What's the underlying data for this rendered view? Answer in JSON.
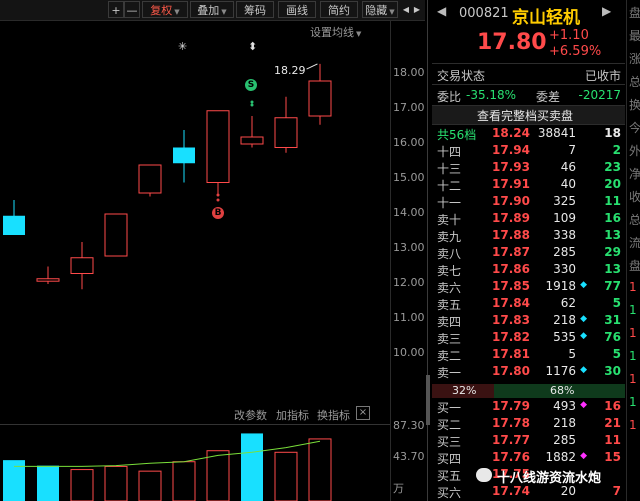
{
  "toolbar": {
    "plus": "+",
    "minus": "—",
    "fuquan": "复权",
    "diejia": "叠加",
    "chouma": "筹码",
    "huaxian": "画线",
    "jianyue": "简约",
    "yincang": "隐藏",
    "prev": "◀",
    "next": "▶"
  },
  "chart": {
    "settings_label": "设置均线",
    "marker_star": "✳",
    "marker_updown": "⬍",
    "high_label": "18.29",
    "s_marker": "S",
    "b_marker": "B",
    "y_ticks": [
      "18.00",
      "17.00",
      "16.00",
      "15.00",
      "14.00",
      "13.00",
      "12.00",
      "11.00",
      "10.00"
    ],
    "vol_ticks": [
      "87.30",
      "43.70",
      "万"
    ],
    "vol_buttons": [
      "改参数",
      "加指标",
      "换指标"
    ],
    "close_glyph": "×"
  },
  "chart_data": {
    "type": "candlestick",
    "candles": [
      {
        "open": 13.4,
        "close": 13.95,
        "high": 14.4,
        "low": 13.4,
        "color": "cyan"
      },
      {
        "open": 12.15,
        "close": 12.08,
        "high": 12.5,
        "low": 12.0,
        "color": "red"
      },
      {
        "open": 12.3,
        "close": 12.75,
        "high": 13.2,
        "low": 11.85,
        "color": "red"
      },
      {
        "open": 12.8,
        "close": 14.0,
        "high": 14.0,
        "low": 12.8,
        "color": "red"
      },
      {
        "open": 15.4,
        "close": 14.6,
        "high": 15.4,
        "low": 14.5,
        "color": "red"
      },
      {
        "open": 15.9,
        "close": 15.45,
        "high": 16.4,
        "low": 14.9,
        "color": "cyan"
      },
      {
        "open": 14.9,
        "close": 16.95,
        "high": 16.95,
        "low": 14.5,
        "color": "red"
      },
      {
        "open": 16.0,
        "close": 16.2,
        "high": 16.8,
        "low": 15.9,
        "color": "red"
      },
      {
        "open": 15.9,
        "close": 16.75,
        "high": 17.35,
        "low": 15.75,
        "color": "red"
      },
      {
        "open": 16.8,
        "close": 17.8,
        "high": 18.29,
        "low": 16.55,
        "color": "red"
      }
    ],
    "volumes": [
      {
        "v": 52,
        "color": "cyan"
      },
      {
        "v": 45,
        "color": "cyan"
      },
      {
        "v": 40,
        "color": "red"
      },
      {
        "v": 44,
        "color": "red"
      },
      {
        "v": 38,
        "color": "red"
      },
      {
        "v": 50,
        "color": "red"
      },
      {
        "v": 64,
        "color": "red"
      },
      {
        "v": 86,
        "color": "cyan"
      },
      {
        "v": 62,
        "color": "red"
      },
      {
        "v": 79,
        "color": "red"
      }
    ],
    "ma_line": [
      44,
      44,
      44,
      45,
      48,
      50,
      58,
      62,
      68,
      76
    ],
    "ylim": [
      9.6,
      18.8
    ],
    "vol_max": 98
  },
  "header": {
    "code": "000821",
    "name": "京山轻机",
    "price": "17.80",
    "change": "+1.10",
    "change_pct": "+6.59%"
  },
  "status": {
    "label": "交易状态",
    "value": "已收市"
  },
  "ratio": {
    "weibi_label": "委比",
    "weibi": "-35.18%",
    "weicha_label": "委差",
    "weicha": "-20217"
  },
  "view_full": "查看完整档买卖盘",
  "total": {
    "label": "共56档",
    "price": "18.24",
    "vol": "38841",
    "cnt": "18"
  },
  "asks": [
    {
      "label": "十四",
      "price": "17.94",
      "vol": "7",
      "mark": "",
      "cnt": "2"
    },
    {
      "label": "十三",
      "price": "17.93",
      "vol": "46",
      "mark": "",
      "cnt": "23"
    },
    {
      "label": "十二",
      "price": "17.91",
      "vol": "40",
      "mark": "",
      "cnt": "20"
    },
    {
      "label": "十一",
      "price": "17.90",
      "vol": "325",
      "mark": "",
      "cnt": "11"
    },
    {
      "label": "卖十",
      "price": "17.89",
      "vol": "109",
      "mark": "",
      "cnt": "16"
    },
    {
      "label": "卖九",
      "price": "17.88",
      "vol": "338",
      "mark": "",
      "cnt": "13"
    },
    {
      "label": "卖八",
      "price": "17.87",
      "vol": "285",
      "mark": "",
      "cnt": "29"
    },
    {
      "label": "卖七",
      "price": "17.86",
      "vol": "330",
      "mark": "",
      "cnt": "13"
    },
    {
      "label": "卖六",
      "price": "17.85",
      "vol": "1918",
      "mark": "◆",
      "cnt": "77"
    },
    {
      "label": "卖五",
      "price": "17.84",
      "vol": "62",
      "mark": "",
      "cnt": "5"
    },
    {
      "label": "卖四",
      "price": "17.83",
      "vol": "218",
      "mark": "◆",
      "cnt": "31"
    },
    {
      "label": "卖三",
      "price": "17.82",
      "vol": "535",
      "mark": "◆",
      "cnt": "76"
    },
    {
      "label": "卖二",
      "price": "17.81",
      "vol": "5",
      "mark": "",
      "cnt": "5"
    },
    {
      "label": "卖一",
      "price": "17.80",
      "vol": "1176",
      "mark": "◆",
      "cnt": "30"
    }
  ],
  "split": {
    "left": "32%",
    "right": "68%"
  },
  "bids": [
    {
      "label": "买一",
      "price": "17.79",
      "vol": "493",
      "mark": "◆",
      "cnt": "16"
    },
    {
      "label": "买二",
      "price": "17.78",
      "vol": "218",
      "mark": "",
      "cnt": "21"
    },
    {
      "label": "买三",
      "price": "17.77",
      "vol": "285",
      "mark": "",
      "cnt": "11"
    },
    {
      "label": "买四",
      "price": "17.76",
      "vol": "1882",
      "mark": "◆",
      "cnt": "15"
    },
    {
      "label": "买五",
      "price": "17.75",
      "vol": "",
      "mark": "",
      "cnt": ""
    },
    {
      "label": "买六",
      "price": "17.74",
      "vol": "20",
      "mark": "",
      "cnt": "7"
    }
  ],
  "edge_glyphs": [
    "盘",
    "最",
    "涨",
    "总",
    "换",
    "今",
    "外",
    "净",
    "收",
    "总",
    "流",
    "盘",
    "1",
    "1",
    "1",
    "1",
    "1",
    "1",
    "1"
  ],
  "watermark": "十八线游资流水炮",
  "colors": {
    "red": "#ff4a4a",
    "green": "#28e070",
    "cyan": "#18e0ff",
    "magenta": "#ff30ff"
  }
}
